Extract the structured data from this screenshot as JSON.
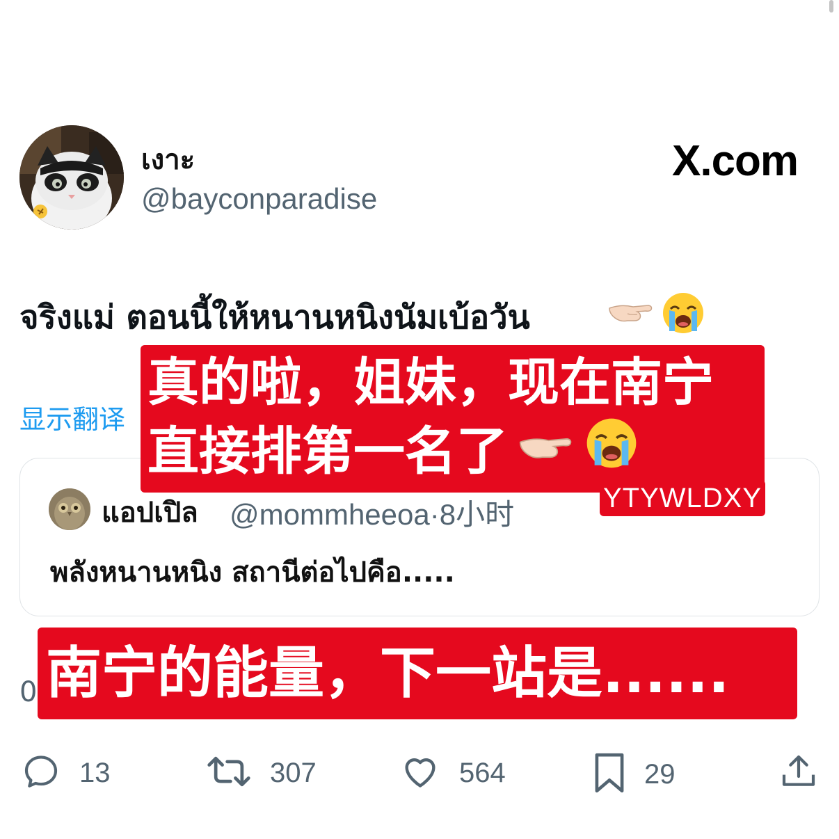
{
  "tweet": {
    "author_name": "เงาะ",
    "author_handle": "@bayconparadise",
    "site_logo": "X.com",
    "text": "จริงแม่ ตอนนี้ให้หนานหนิงนัมเบ้อวัน",
    "text_emojis": [
      "pointing-hand-icon",
      "loudly-crying-face-icon"
    ],
    "translate_label": "显示翻译"
  },
  "quote": {
    "author_name": "แอปเปิล",
    "author_handle": "@mommheeoa",
    "separator": "·",
    "time": "8小时",
    "text": "พลังหนานหนิง สถานีต่อไปคือ....."
  },
  "overlay": {
    "line1": "真的啦，姐妹，现在南宁",
    "line2": "直接排第一名了",
    "tag": "YTYWLDXY",
    "bottom": "南宁的能量，下一站是......"
  },
  "partial_text": "0",
  "actions": {
    "reply_count": "13",
    "retweet_count": "307",
    "like_count": "564",
    "bookmark_count": "29"
  },
  "colors": {
    "overlay_red": "#e5091e",
    "link_blue": "#1d9bf0",
    "secondary_text": "#536471"
  }
}
